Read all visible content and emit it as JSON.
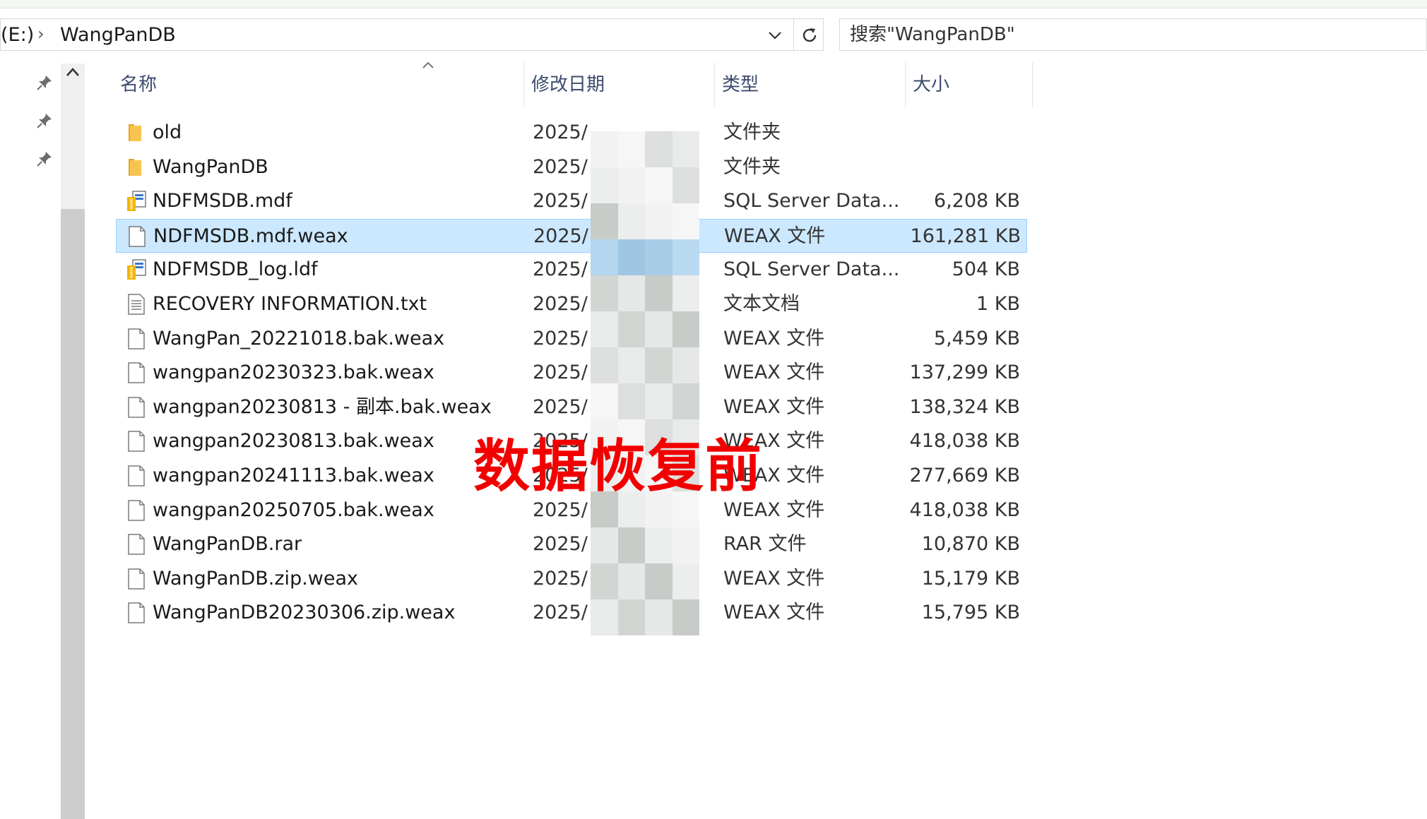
{
  "address_bar": {
    "drive": "(E:)",
    "separator": "›",
    "folder": "WangPanDB"
  },
  "search": {
    "placeholder": "搜索\"WangPanDB\""
  },
  "columns": {
    "name": "名称",
    "date": "修改日期",
    "type": "类型",
    "size": "大小"
  },
  "files": [
    {
      "name": "old",
      "date": "2025/",
      "type": "文件夹",
      "size": "",
      "icon": "folder-icon"
    },
    {
      "name": "WangPanDB",
      "date": "2025/",
      "type": "文件夹",
      "size": "",
      "icon": "folder-icon"
    },
    {
      "name": "NDFMSDB.mdf",
      "date": "2025/",
      "type": "SQL Server Data...",
      "size": "6,208 KB",
      "icon": "database-file-icon"
    },
    {
      "name": "NDFMSDB.mdf.weax",
      "date": "2025/",
      "type": "WEAX 文件",
      "size": "161,281 KB",
      "icon": "blank-file-icon",
      "selected": true
    },
    {
      "name": "NDFMSDB_log.ldf",
      "date": "2025/",
      "type": "SQL Server Data...",
      "size": "504 KB",
      "icon": "database-file-icon"
    },
    {
      "name": "RECOVERY INFORMATION.txt",
      "date": "2025/",
      "type": "文本文档",
      "size": "1 KB",
      "icon": "text-file-icon"
    },
    {
      "name": "WangPan_20221018.bak.weax",
      "date": "2025/",
      "type": "WEAX 文件",
      "size": "5,459 KB",
      "icon": "blank-file-icon"
    },
    {
      "name": "wangpan20230323.bak.weax",
      "date": "2025/",
      "type": "WEAX 文件",
      "size": "137,299 KB",
      "icon": "blank-file-icon"
    },
    {
      "name": "wangpan20230813 - 副本.bak.weax",
      "date": "2025/",
      "type": "WEAX 文件",
      "size": "138,324 KB",
      "icon": "blank-file-icon"
    },
    {
      "name": "wangpan20230813.bak.weax",
      "date": "2025/",
      "type": "WEAX 文件",
      "size": "418,038 KB",
      "icon": "blank-file-icon"
    },
    {
      "name": "wangpan20241113.bak.weax",
      "date": "2025/",
      "type": "WEAX 文件",
      "size": "277,669 KB",
      "icon": "blank-file-icon"
    },
    {
      "name": "wangpan20250705.bak.weax",
      "date": "2025/",
      "type": "WEAX 文件",
      "size": "418,038 KB",
      "icon": "blank-file-icon"
    },
    {
      "name": "WangPanDB.rar",
      "date": "2025/",
      "type": "RAR 文件",
      "size": "10,870 KB",
      "icon": "blank-file-icon"
    },
    {
      "name": "WangPanDB.zip.weax",
      "date": "2025/",
      "type": "WEAX 文件",
      "size": "15,179 KB",
      "icon": "blank-file-icon"
    },
    {
      "name": "WangPanDB20230306.zip.weax",
      "date": "2025/",
      "type": "WEAX 文件",
      "size": "15,795 KB",
      "icon": "blank-file-icon"
    }
  ],
  "overlay_label": "数据恢复前",
  "colors": {
    "selection_bg": "#cce8ff",
    "selection_border": "#99d1ff",
    "header_text": "#3c4b6e",
    "overlay_red": "#f20000",
    "folder_yellow": "#f8c44f"
  }
}
